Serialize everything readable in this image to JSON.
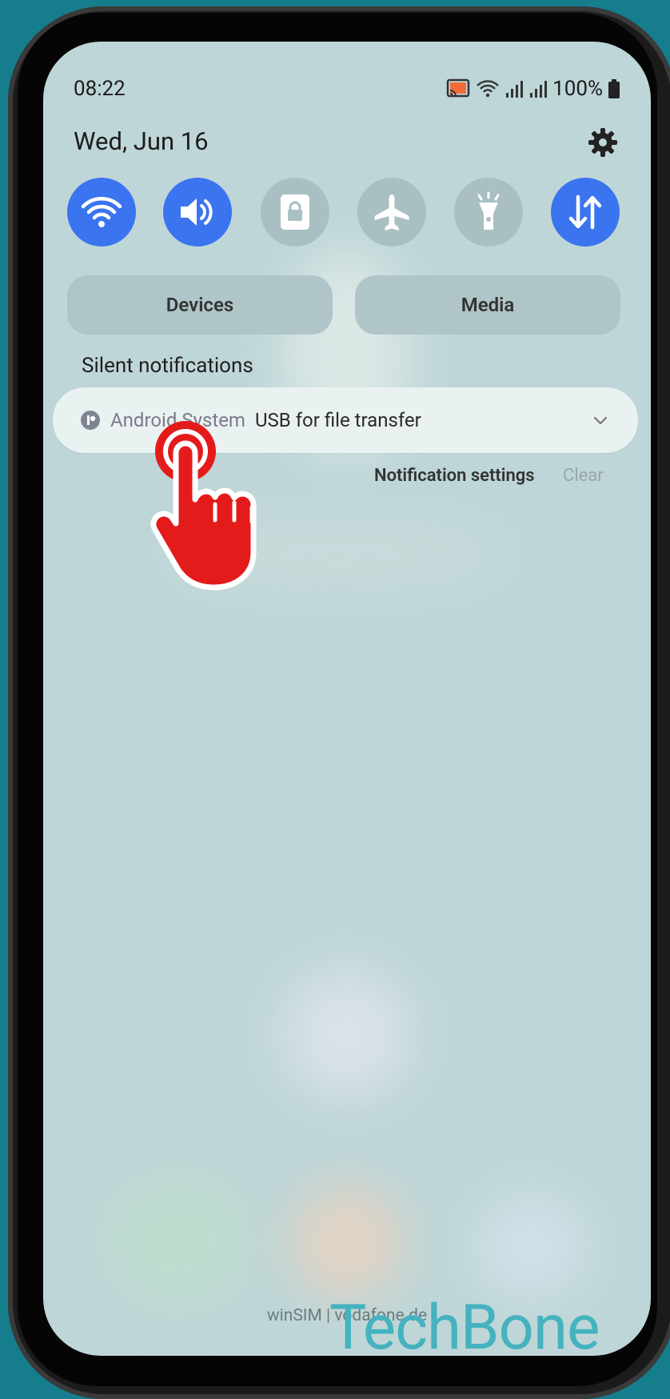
{
  "status_bar": {
    "time": "08:22",
    "battery": "100%"
  },
  "header": {
    "date": "Wed, Jun 16"
  },
  "quick_settings": [
    {
      "name": "wifi",
      "state": "on"
    },
    {
      "name": "sound",
      "state": "on"
    },
    {
      "name": "screen-lock",
      "state": "off"
    },
    {
      "name": "airplane",
      "state": "off"
    },
    {
      "name": "flashlight",
      "state": "off"
    },
    {
      "name": "mobile-data",
      "state": "on"
    }
  ],
  "pills": {
    "devices": "Devices",
    "media": "Media"
  },
  "section": {
    "silent_label": "Silent notifications"
  },
  "notification": {
    "app": "Android System",
    "title": "USB for file transfer"
  },
  "actions": {
    "settings": "Notification settings",
    "clear": "Clear"
  },
  "footer": {
    "operator": "winSIM | vodafone.de"
  },
  "watermark": "TechBone",
  "colors": {
    "accent": "#3b74ef",
    "background": "#bfd6d8",
    "pointer": "#e31b1b"
  }
}
